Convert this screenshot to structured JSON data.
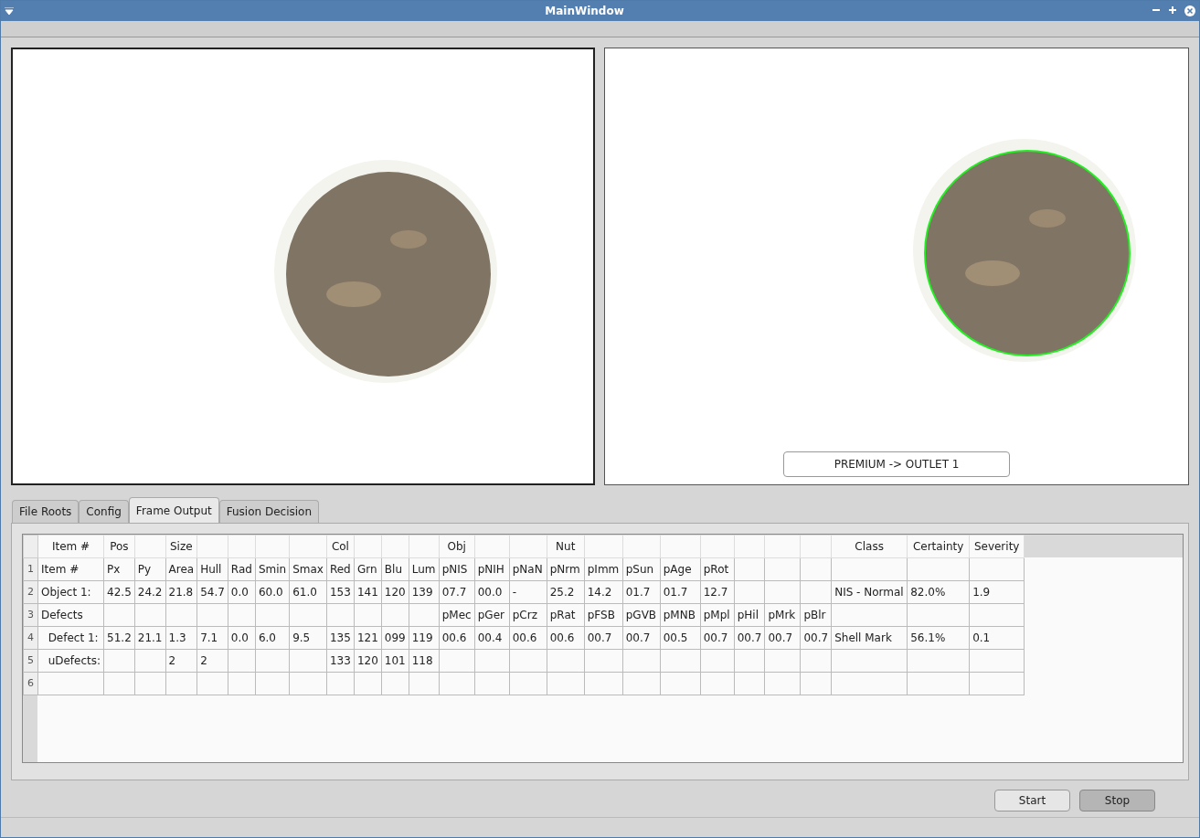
{
  "window": {
    "title": "MainWindow"
  },
  "result_label": "PREMIUM -> OUTLET 1",
  "tabs": [
    {
      "label": "File Roots",
      "selected": false
    },
    {
      "label": "Config",
      "selected": false
    },
    {
      "label": "Frame Output",
      "selected": true
    },
    {
      "label": "Fusion Decision",
      "selected": false
    }
  ],
  "table": {
    "columns": [
      {
        "label": "Item #"
      },
      {
        "label": "Pos"
      },
      {},
      {
        "label": "Size"
      },
      {},
      {},
      {},
      {},
      {
        "label": "Col"
      },
      {},
      {},
      {},
      {
        "label": "Obj"
      },
      {},
      {},
      {
        "label": "Nut"
      },
      {},
      {},
      {},
      {},
      {},
      {},
      {},
      {
        "label": "Class"
      },
      {
        "label": "Certainty"
      },
      {
        "label": "Severity"
      }
    ],
    "rows": [
      {
        "number": "1",
        "cells": [
          "Item #",
          "Px",
          "Py",
          "Area",
          "Hull",
          "Rad",
          "Smin",
          "Smax",
          "Red",
          "Grn",
          "Blu",
          "Lum",
          "pNIS",
          "pNIH",
          "pNaN",
          "pNrm",
          "pImm",
          "pSun",
          "pAge",
          "pRot",
          null,
          null,
          null,
          null,
          null,
          null
        ]
      },
      {
        "number": "2",
        "cells": [
          "Object 1:",
          "42.5",
          "24.2",
          "21.8",
          "54.7",
          "0.0",
          "60.0",
          "61.0",
          "153",
          "141",
          "120",
          "139",
          "07.7",
          "00.0",
          "-",
          "25.2",
          "14.2",
          "01.7",
          "01.7",
          "12.7",
          null,
          null,
          null,
          "NIS - Normal",
          "82.0%",
          "1.9"
        ]
      },
      {
        "number": "3",
        "cells": [
          "Defects",
          null,
          null,
          null,
          null,
          null,
          null,
          null,
          null,
          null,
          null,
          null,
          "pMec",
          "pGer",
          "pCrz",
          "pRat",
          "pFSB",
          "pGVB",
          "pMNB",
          "pMpl",
          "pHil",
          "pMrk",
          "pBlr",
          null,
          null,
          null
        ]
      },
      {
        "number": "4",
        "cells": [
          "  Defect 1:",
          "51.2",
          "21.1",
          "1.3",
          "7.1",
          "0.0",
          "6.0",
          "9.5",
          "135",
          "121",
          "099",
          "119",
          "00.6",
          "00.4",
          "00.6",
          "00.6",
          "00.7",
          "00.7",
          "00.5",
          "00.7",
          "00.7",
          "00.7",
          "00.7",
          "Shell Mark",
          "56.1%",
          "0.1"
        ]
      },
      {
        "number": "5",
        "cells": [
          "  uDefects:",
          null,
          null,
          "2",
          "2",
          null,
          null,
          null,
          "133",
          "120",
          "101",
          "118",
          null,
          null,
          null,
          null,
          null,
          null,
          null,
          null,
          null,
          null,
          null,
          null,
          null,
          null
        ]
      },
      {
        "number": "6",
        "cells": [
          null,
          null,
          null,
          null,
          null,
          null,
          null,
          null,
          null,
          null,
          null,
          null,
          null,
          null,
          null,
          null,
          null,
          null,
          null,
          null,
          null,
          null,
          null,
          null,
          null,
          null
        ]
      }
    ]
  },
  "buttons": [
    {
      "label": "Start",
      "pressed": false
    },
    {
      "label": "Stop",
      "pressed": true
    }
  ]
}
